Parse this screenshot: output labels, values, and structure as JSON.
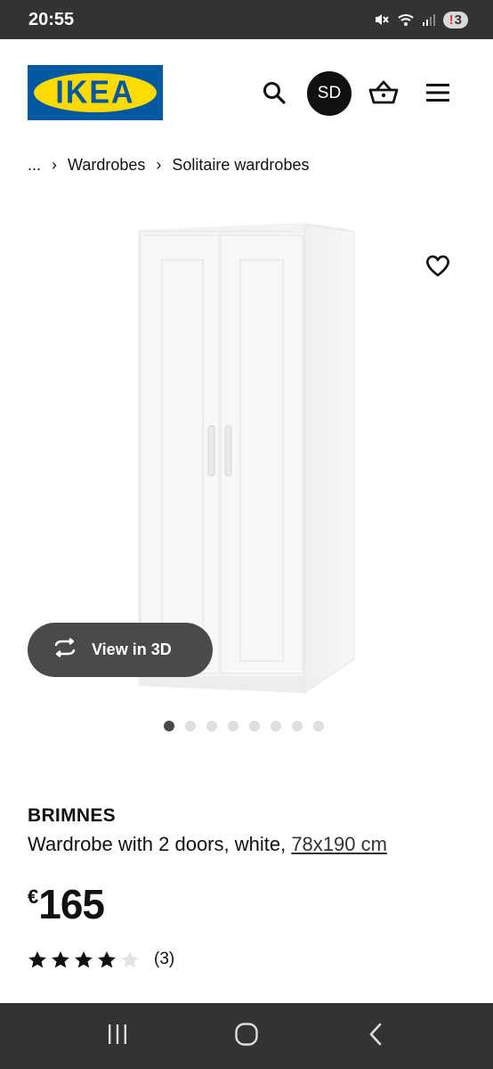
{
  "status_bar": {
    "time": "20:55",
    "notification_count": "3",
    "icons": [
      "mute-icon",
      "wifi-icon",
      "signal-icon"
    ]
  },
  "header": {
    "logo_text": "IKEA",
    "avatar_initials": "SD",
    "icons": [
      "search-icon",
      "basket-icon",
      "menu-icon"
    ]
  },
  "breadcrumb": {
    "ellipsis": "...",
    "items": [
      "Wardrobes",
      "Solitaire wardrobes"
    ],
    "separator": "›"
  },
  "gallery": {
    "view_3d_label": "View in 3D",
    "total_images": 8,
    "active_index": 0
  },
  "product": {
    "name": "BRIMNES",
    "description": "Wardrobe with 2 doors, white, ",
    "size": "78x190 cm",
    "currency": "€",
    "price": "165",
    "rating_value": 4,
    "rating_max": 5,
    "rating_count": "(3)"
  },
  "colors": {
    "ikea_blue": "#0058a3",
    "ikea_yellow": "#ffdb00",
    "bar_dark": "#333333"
  }
}
